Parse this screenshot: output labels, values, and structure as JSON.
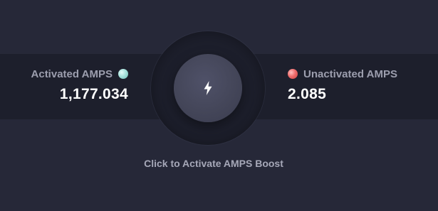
{
  "activated": {
    "label": "Activated AMPS",
    "value": "1,177.034",
    "dot_color": "#a7e2dc"
  },
  "unactivated": {
    "label": "Unactivated AMPS",
    "value": "2.085",
    "dot_color": "#ef6d6d"
  },
  "boost": {
    "icon": "lightning-bolt-icon",
    "caption": "Click to Activate AMPS Boost"
  },
  "colors": {
    "background": "#262838",
    "band": "#1d1f2c",
    "button": "#47495d"
  }
}
